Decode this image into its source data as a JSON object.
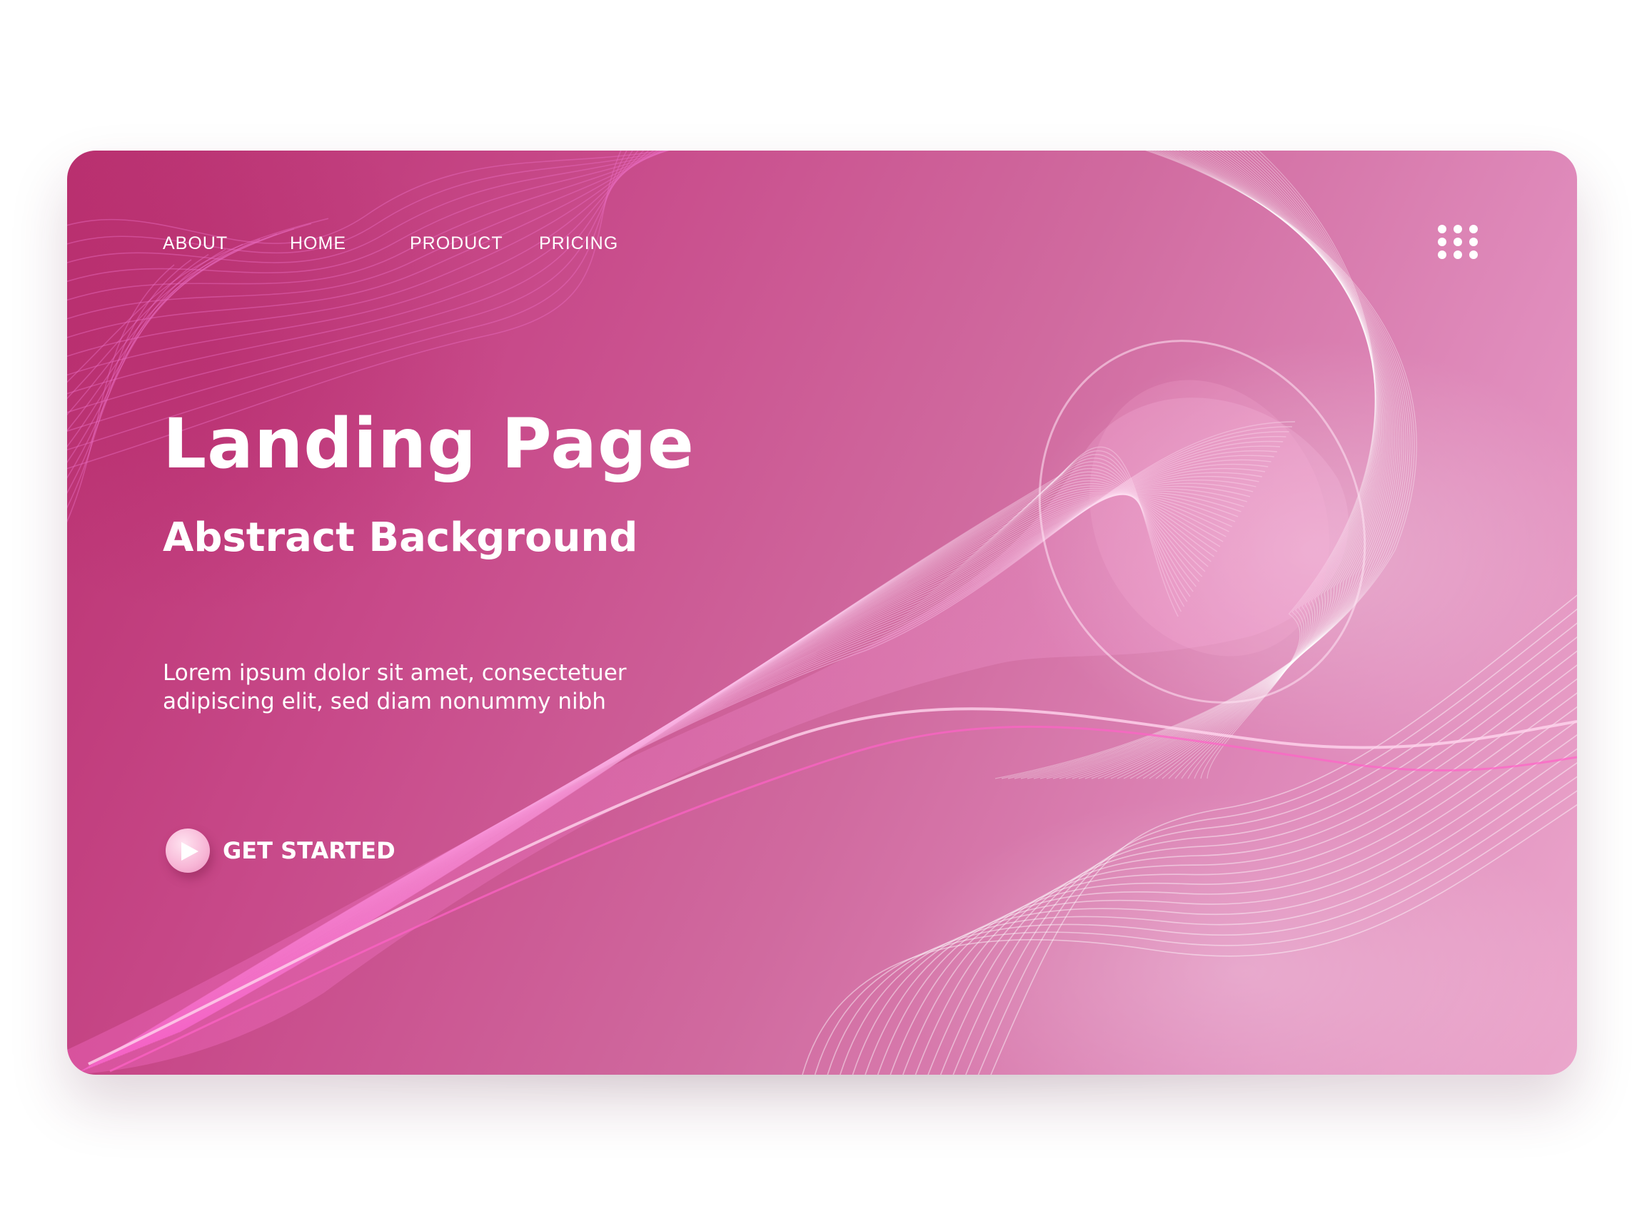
{
  "nav": {
    "items": [
      {
        "label": "ABOUT"
      },
      {
        "label": "HOME"
      },
      {
        "label": "PRODUCT"
      },
      {
        "label": "PRICING"
      }
    ],
    "menu_icon": "grid-dots-icon"
  },
  "hero": {
    "title": "Landing Page",
    "subtitle": "Abstract Background",
    "body_lines": [
      "Lorem ipsum dolor sit amet, consectetuer",
      "adipiscing elit, sed diam nonummy nibh"
    ],
    "cta_label": "GET STARTED",
    "cta_icon": "play-icon"
  },
  "colors": {
    "card_start": "#b9306f",
    "card_end": "#eba7cc",
    "wave": "#f05cc0",
    "text": "#ffffff"
  }
}
